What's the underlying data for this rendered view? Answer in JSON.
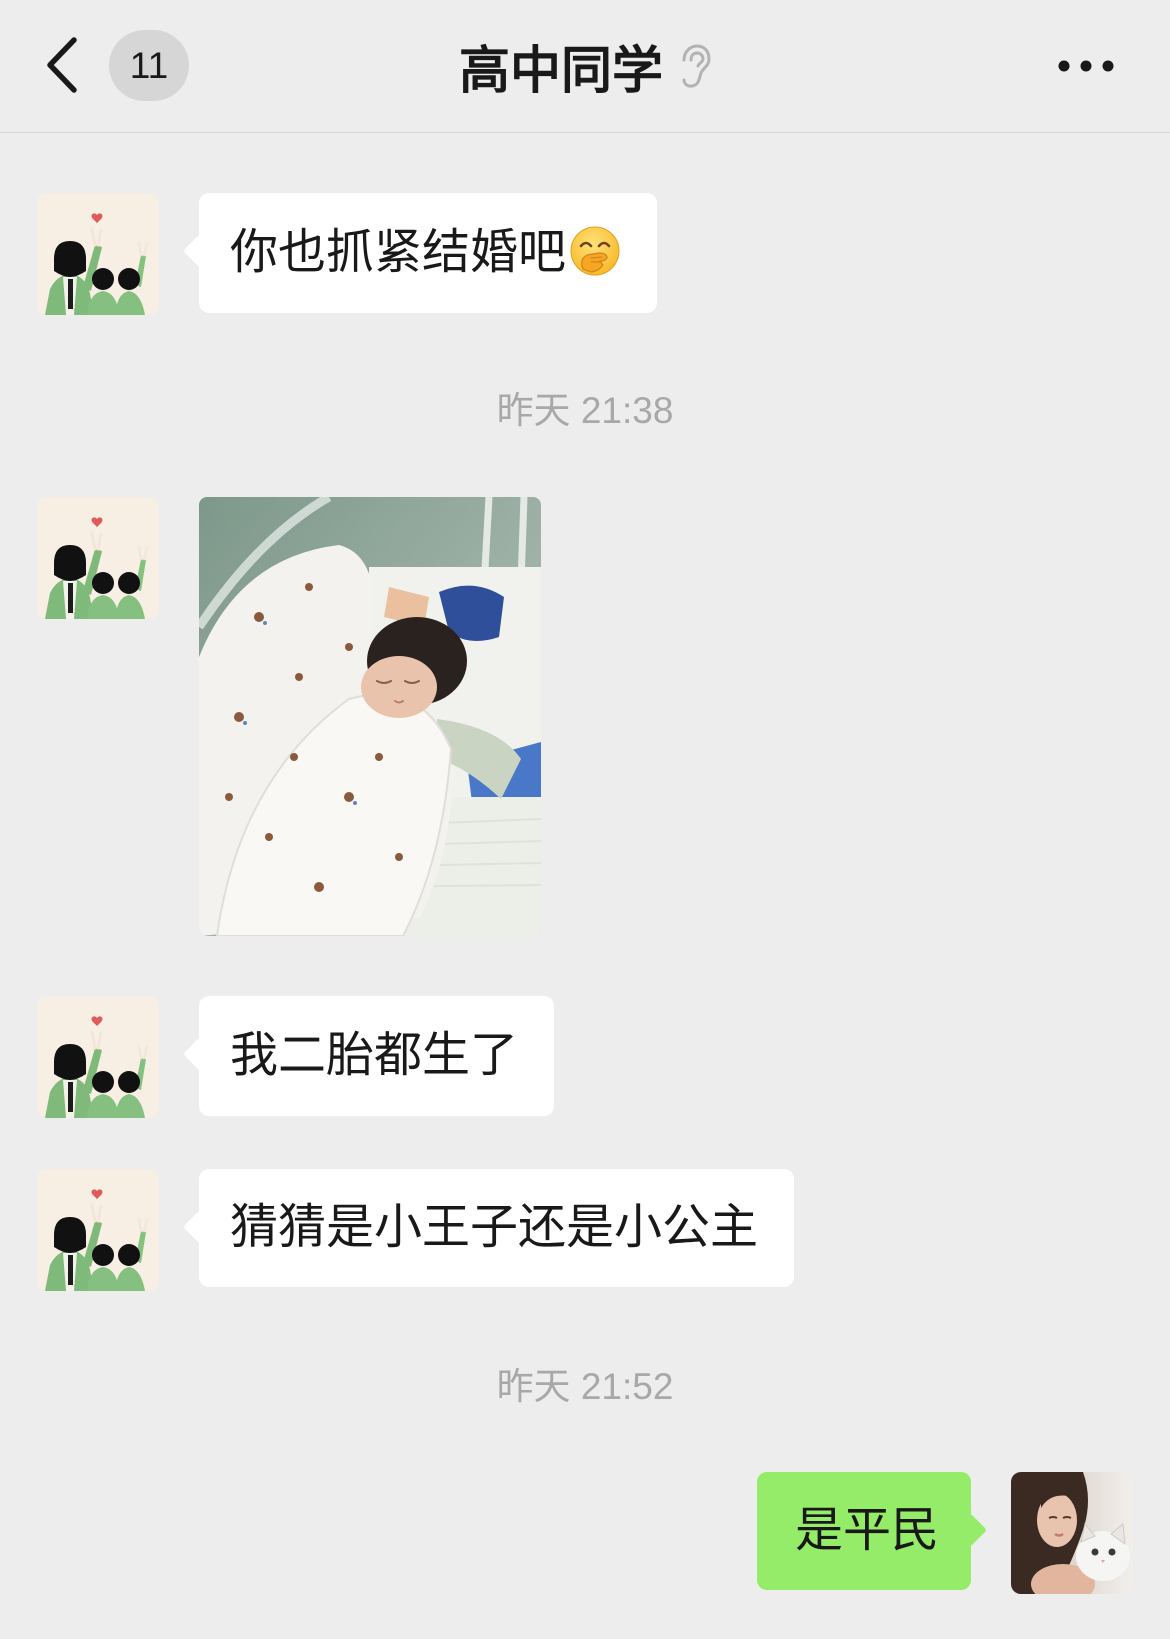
{
  "header": {
    "unread_count": "11",
    "title": "高中同学"
  },
  "messages": [
    {
      "text": "你也抓紧结婚吧",
      "emoji_icon": "hand-over-mouth-emoji-icon"
    },
    {
      "text": "我二胎都生了"
    },
    {
      "text": "猜猜是小王子还是小公主"
    },
    {
      "text": "是平民"
    }
  ],
  "timestamps": [
    "昨天 21:38",
    "昨天 21:52"
  ],
  "icons": {
    "back": "chevron-left-icon",
    "listen_mode": "ear-icon",
    "more": "more-dots-icon",
    "friend_avatar": "friend-avatar-icon",
    "my_avatar": "my-avatar-icon"
  },
  "colors": {
    "background": "#ededed",
    "incoming_bubble": "#ffffff",
    "outgoing_bubble": "#95ec69",
    "timestamp_text": "#a8a8a8",
    "badge": "#d6d6d6",
    "text": "#191919"
  }
}
